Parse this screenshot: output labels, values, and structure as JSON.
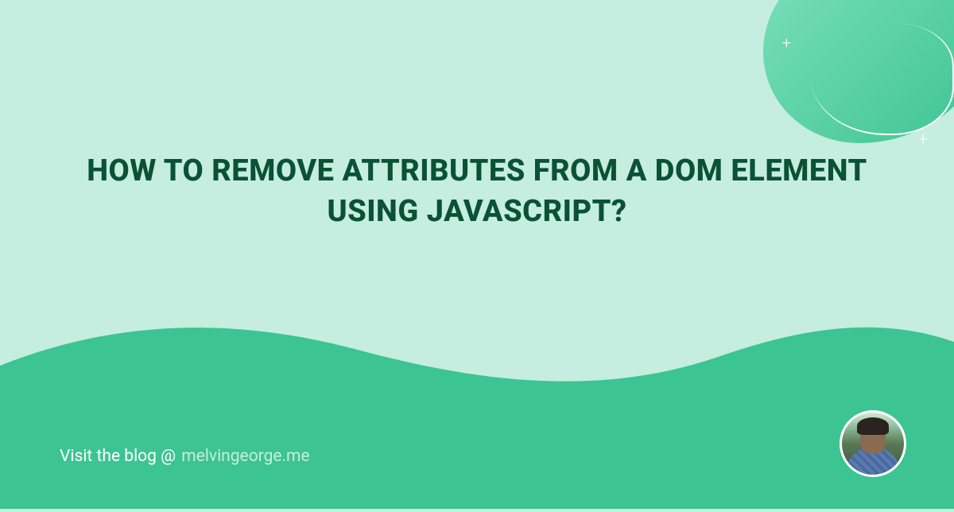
{
  "title": "HOW TO REMOVE ATTRIBUTES FROM A DOM ELEMENT USING JAVASCRIPT?",
  "footer": {
    "prefix": "Visit the blog @",
    "domain": "melvingeorge.me"
  },
  "colors": {
    "background": "#c5ede0",
    "accent": "#3cc492",
    "titleColor": "#0a5138"
  }
}
